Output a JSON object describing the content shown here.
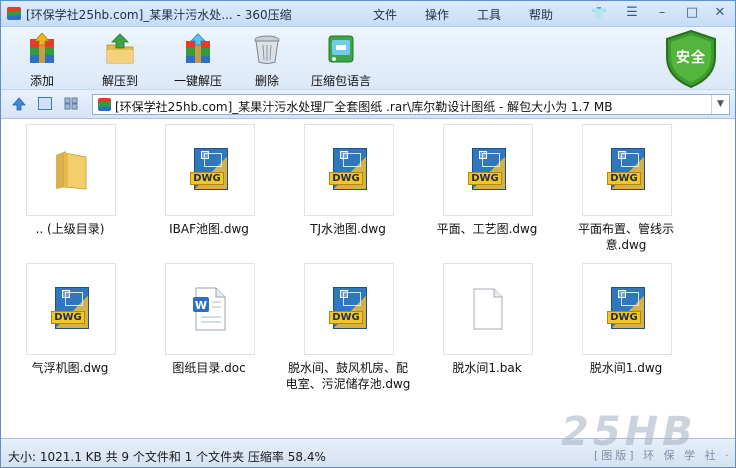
{
  "window": {
    "title": "[环保学社25hb.com]_某果汁污水处... - 360压缩",
    "menus": [
      "文件",
      "操作",
      "工具",
      "帮助"
    ],
    "controls": {
      "skin": "👕",
      "menu": "☰",
      "minimize": "–",
      "maximize": "□",
      "close": "✕"
    }
  },
  "toolbar": {
    "add": "添加",
    "extract": "解压到",
    "one_click": "一键解压",
    "delete": "删除",
    "language": "压缩包语言",
    "security": "安全"
  },
  "address": {
    "path": "[环保学社25hb.com]_某果汁污水处理厂全套图纸 .rar\\库尔勒设计图纸 - 解包大小为 1.7 MB",
    "dropdown": "▼"
  },
  "files": [
    {
      "name": ".. (上级目录)",
      "icon": "folder-icon",
      "icon_text": ""
    },
    {
      "name": "IBAF池图.dwg",
      "icon": "dwg-file-icon",
      "icon_text": "DWG"
    },
    {
      "name": "TJ水池图.dwg",
      "icon": "dwg-file-icon",
      "icon_text": "DWG"
    },
    {
      "name": "平面、工艺图.dwg",
      "icon": "dwg-file-icon",
      "icon_text": "DWG"
    },
    {
      "name": "平面布置、管线示意.dwg",
      "icon": "dwg-file-icon",
      "icon_text": "DWG"
    },
    {
      "name": "气浮机图.dwg",
      "icon": "dwg-file-icon",
      "icon_text": "DWG"
    },
    {
      "name": "图纸目录.doc",
      "icon": "doc-file-icon",
      "icon_text": "W"
    },
    {
      "name": "脱水间、鼓风机房、配电室、污泥储存池.dwg",
      "icon": "dwg-file-icon",
      "icon_text": "DWG"
    },
    {
      "name": "脱水间1.bak",
      "icon": "blank-file-icon",
      "icon_text": ""
    },
    {
      "name": "脱水间1.dwg",
      "icon": "dwg-file-icon",
      "icon_text": "DWG"
    }
  ],
  "status": {
    "text": "大小: 1021.1 KB 共 9 个文件和 1 个文件夹 压缩率 58.4%"
  },
  "watermark": {
    "logo": "25HB",
    "sub": "[图版] 环 保 学 社 · com"
  },
  "colors": {
    "accent": "#2d6fc6",
    "shield": "#3d9a2c",
    "dwg_band": "#f3c622"
  }
}
